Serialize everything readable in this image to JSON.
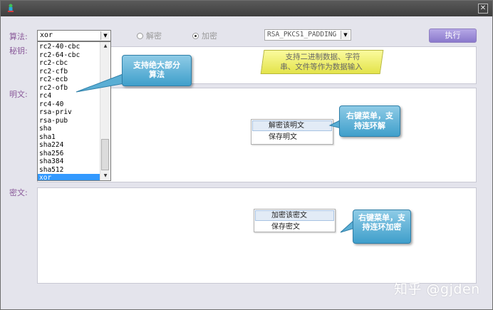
{
  "form": {
    "algorithm_label": "算法:",
    "key_label": "秘钥:",
    "plaintext_label": "明文:",
    "ciphertext_label": "密文:",
    "algorithm_value": "xor",
    "decrypt_label": "解密",
    "encrypt_label": "加密",
    "padding_value": "RSA_PKCS1_PADDING",
    "execute_label": "执行"
  },
  "algorithm_list": [
    "rc2-40-cbc",
    "rc2-64-cbc",
    "rc2-cbc",
    "rc2-cfb",
    "rc2-ecb",
    "rc2-ofb",
    "rc4",
    "rc4-40",
    "rsa-priv",
    "rsa-pub",
    "sha",
    "sha1",
    "sha224",
    "sha256",
    "sha384",
    "sha512",
    "xor"
  ],
  "callouts": {
    "algorithms": "支持绝大部分算法",
    "binary_line1": "支持二进制数据、字符",
    "binary_line2": "串、文件等作为数据输入",
    "plaintext_menu": "右键菜单，支持连环解",
    "ciphertext_menu": "右键菜单，支持连环加密"
  },
  "plaintext_menu": {
    "item1": "解密该明文",
    "item2": "保存明文"
  },
  "ciphertext_menu": {
    "item1": "加密该密文",
    "item2": "保存密文"
  },
  "watermark": "知乎 @gjden",
  "window": {
    "close_glyph": "✕"
  }
}
